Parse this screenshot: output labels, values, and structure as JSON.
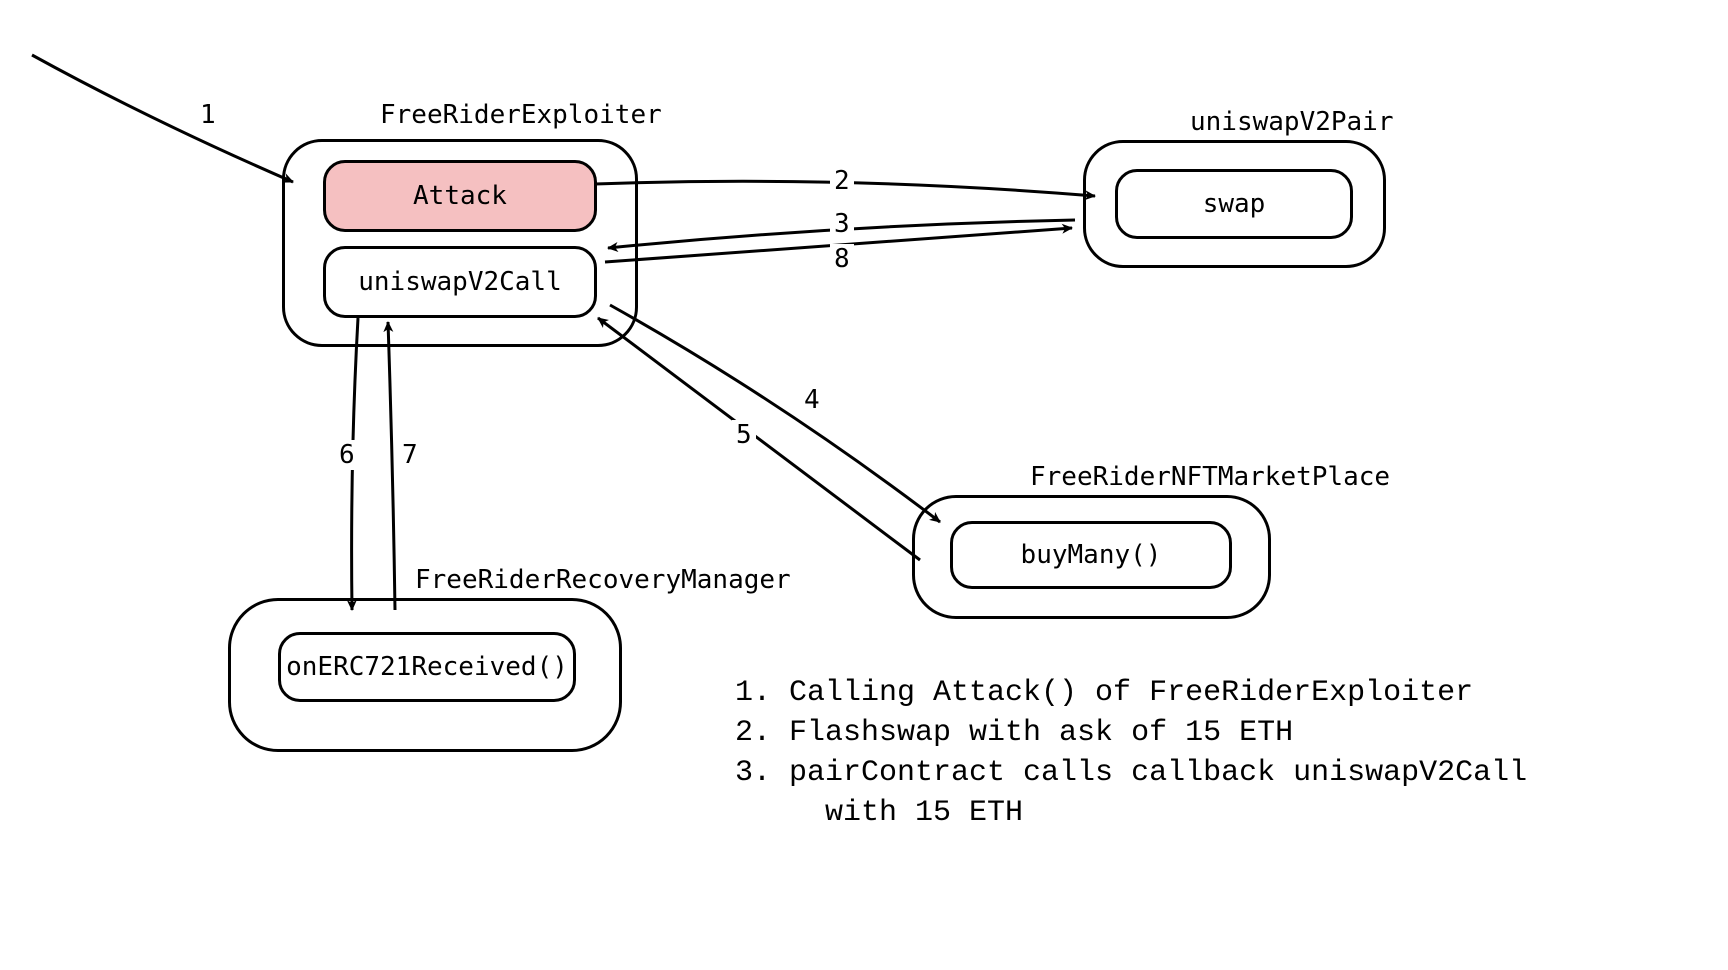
{
  "nodes": {
    "exploiter": {
      "title": "FreeRiderExploiter",
      "attack": "Attack",
      "callback": "uniswapV2Call"
    },
    "pair": {
      "title": "uniswapV2Pair",
      "swap": "swap"
    },
    "marketplace": {
      "title": "FreeRiderNFTMarketPlace",
      "buy": "buyMany()"
    },
    "recovery": {
      "title": "FreeRiderRecoveryManager",
      "received": "onERC721Received()"
    }
  },
  "edges": {
    "e1": "1",
    "e2": "2",
    "e3": "3",
    "e4": "4",
    "e5": "5",
    "e6": "6",
    "e7": "7",
    "e8": "8"
  },
  "legend": {
    "line1": "1. Calling Attack() of FreeRiderExploiter",
    "line2": "2. Flashswap with ask of 15 ETH",
    "line3": "3. pairContract calls callback uniswapV2Call",
    "line3b": "     with 15 ETH"
  }
}
